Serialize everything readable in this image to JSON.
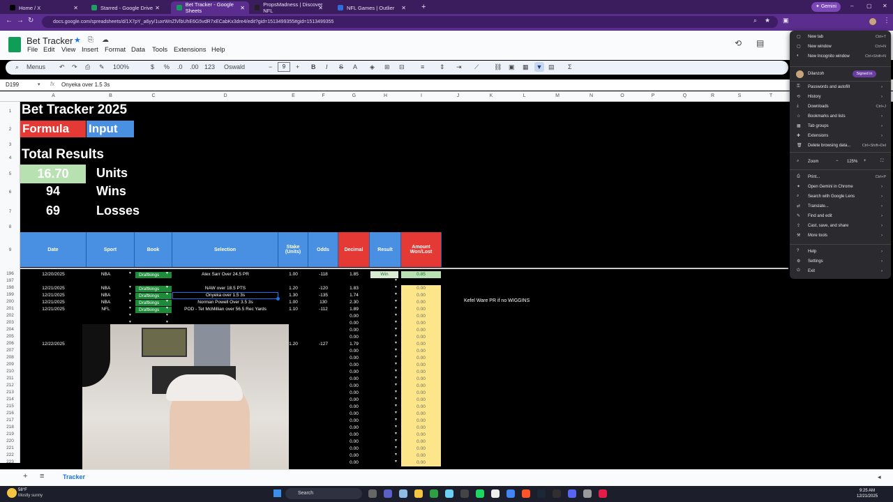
{
  "browser": {
    "tabs": [
      {
        "label": "Home / X",
        "active": false,
        "color": "#000000"
      },
      {
        "label": "Starred - Google Drive",
        "active": false,
        "color": "#1aa260"
      },
      {
        "label": "Bet Tracker - Google Sheets",
        "active": true,
        "color": "#0f9d58"
      },
      {
        "label": "PropsMadness | Discover NFL",
        "active": false,
        "color": "#222222"
      },
      {
        "label": "NFL Games | Outlier",
        "active": false,
        "color": "#2d6cdf"
      }
    ],
    "url": "docs.google.com/spreadsheets/d/1X7pY_a6yy/1uxrWnZlVlbUhE6G5vdR7xECabKx3dre4/edit?gid=1513499355#gid=1513499355",
    "gemini_label": "Gemini"
  },
  "sheets": {
    "title": "Bet Tracker",
    "menus": [
      "File",
      "Edit",
      "View",
      "Insert",
      "Format",
      "Data",
      "Tools",
      "Extensions",
      "Help"
    ],
    "toolbar": {
      "menus_label": "Menus",
      "zoom": "100%",
      "currency": "$",
      "percent": "%",
      "dec_less": ".0",
      "dec_more": ".00",
      "number_format": "123",
      "font": "Oswald",
      "font_size": "9"
    },
    "name_box": "D199",
    "formula": "Onyeka over 1.5 3s",
    "columns": [
      "A",
      "B",
      "C",
      "D",
      "E",
      "F",
      "G",
      "H",
      "I",
      "J",
      "K",
      "L",
      "M",
      "N",
      "O",
      "P",
      "Q",
      "R",
      "S",
      "T"
    ],
    "top_rows": [
      "1",
      "2",
      "3",
      "4",
      "5",
      "6",
      "7",
      "8",
      "9"
    ],
    "data_rows": [
      "196",
      "197",
      "198",
      "199",
      "200",
      "201",
      "202",
      "203",
      "204",
      "205",
      "206",
      "207",
      "208",
      "209",
      "210",
      "211",
      "212",
      "213",
      "214",
      "215",
      "216",
      "217",
      "218",
      "219",
      "220",
      "221",
      "222",
      "223"
    ],
    "heading": "Bet Tracker 2025",
    "formula_label": "Formula",
    "input_label": "Input",
    "total_results": "Total Results",
    "units_value": "16.70",
    "units_label": "Units",
    "wins_value": "94",
    "wins_label": "Wins",
    "losses_value": "69",
    "losses_label": "Losses",
    "headers": {
      "date": "Date",
      "sport": "Sport",
      "book": "Book",
      "selection": "Selection",
      "stake": "Stake (Units)",
      "odds": "Odds",
      "decimal": "Decimal",
      "result": "Result",
      "amount": "Amount Won/Lost"
    },
    "bets": [
      {
        "row": "196",
        "date": "12/20/2025",
        "sport": "NBA",
        "book": "Draftkings",
        "selection": "Alex Sarr Over 24.5 PR",
        "stake": "1.00",
        "odds": "-118",
        "decimal": "1.85",
        "result": "Win",
        "amount": "0.85"
      },
      {
        "row": "198",
        "date": "12/21/2025",
        "sport": "NBA",
        "book": "Draftkings",
        "selection": "NAW over 18.5 PTS",
        "stake": "1.20",
        "odds": "-120",
        "decimal": "1.83",
        "result": "",
        "amount": "0.00"
      },
      {
        "row": "199",
        "date": "12/21/2025",
        "sport": "NBA",
        "book": "Draftkings",
        "selection": "Onyeka over 1.5 3s",
        "stake": "1.30",
        "odds": "-135",
        "decimal": "1.74",
        "result": "",
        "amount": "0.00"
      },
      {
        "row": "200",
        "date": "12/21/2025",
        "sport": "NBA",
        "book": "Draftkings",
        "selection": "Norman Powell Over 3.5 3s",
        "stake": "1.00",
        "odds": "130",
        "decimal": "2.30",
        "result": "",
        "amount": "0.00"
      },
      {
        "row": "201",
        "date": "12/21/2025",
        "sport": "NFL",
        "book": "Draftkings",
        "selection": "POD - Tet McMillian over 56.5 Rec Yards",
        "stake": "1.10",
        "odds": "-112",
        "decimal": "1.89",
        "result": "",
        "amount": "0.00"
      },
      {
        "row": "206",
        "date": "12/22/2025",
        "sport": "",
        "book": "",
        "selection": "",
        "stake": "1.20",
        "odds": "-127",
        "decimal": "1.79",
        "result": "",
        "amount": "0.00"
      }
    ],
    "note": "Kefel Ware PR if no WIGGINS",
    "zero": "0.00",
    "sheet_tab": "Tracker"
  },
  "chrome_menu": {
    "items": [
      {
        "label": "New tab",
        "shortcut": "Ctrl+T"
      },
      {
        "label": "New window",
        "shortcut": "Ctrl+N"
      },
      {
        "label": "New Incognito window",
        "shortcut": "Ctrl+Shift+N"
      }
    ],
    "profile": {
      "name": "Dilanzoh",
      "status": "Signed in"
    },
    "items2": [
      {
        "label": "Passwords and autofill",
        "shortcut": ""
      },
      {
        "label": "History",
        "shortcut": ""
      },
      {
        "label": "Downloads",
        "shortcut": "Ctrl+J"
      },
      {
        "label": "Bookmarks and lists",
        "shortcut": ""
      },
      {
        "label": "Tab groups",
        "shortcut": ""
      },
      {
        "label": "Extensions",
        "shortcut": ""
      },
      {
        "label": "Delete browsing data...",
        "shortcut": "Ctrl+Shift+Del"
      }
    ],
    "zoom_label": "Zoom",
    "zoom_value": "125%",
    "items3": [
      {
        "label": "Print...",
        "shortcut": "Ctrl+P"
      },
      {
        "label": "Open Gemini in Chrome",
        "shortcut": ""
      },
      {
        "label": "Search with Google Lens",
        "shortcut": ""
      },
      {
        "label": "Translate...",
        "shortcut": ""
      },
      {
        "label": "Find and edit",
        "shortcut": ""
      },
      {
        "label": "Cast, save, and share",
        "shortcut": ""
      },
      {
        "label": "More tools",
        "shortcut": ""
      }
    ],
    "items4": [
      {
        "label": "Help",
        "shortcut": ""
      },
      {
        "label": "Settings",
        "shortcut": ""
      },
      {
        "label": "Exit",
        "shortcut": ""
      }
    ]
  },
  "taskbar": {
    "weather_temp": "58°F",
    "weather_desc": "Mostly sunny",
    "search": "Search",
    "time": "9:25 AM",
    "date": "12/21/2025"
  }
}
